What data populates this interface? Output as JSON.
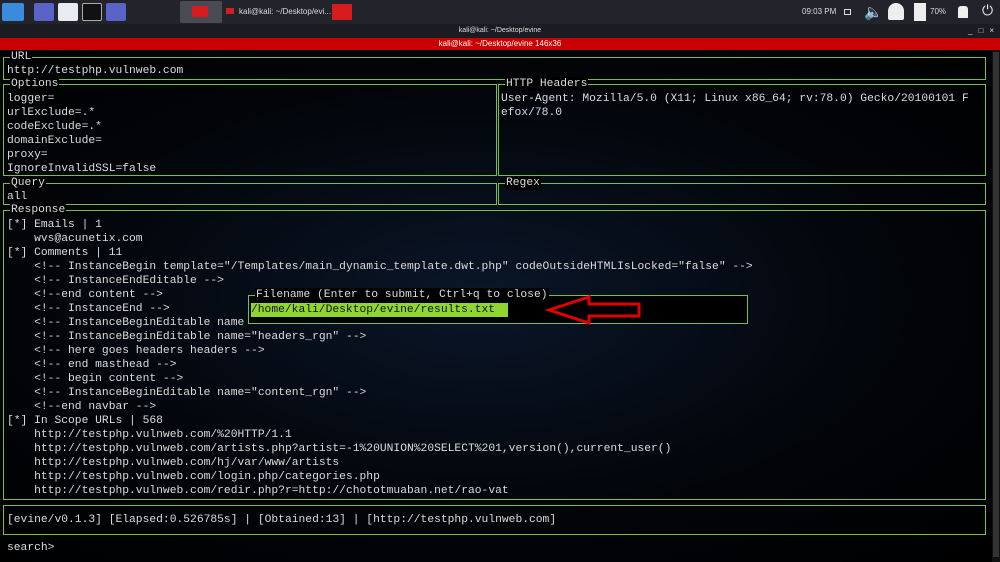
{
  "taskbar": {
    "window_title": "kali@kali: ~/Desktop/evi...",
    "clock": "09:03 PM",
    "battery": "70%",
    "icons": [
      "kali-logo-icon",
      "workspace-icon",
      "folder-icon",
      "terminal-icon",
      "screen-recorder-icon",
      "volume-icon",
      "bell-icon",
      "battery-icon",
      "lock-icon",
      "logout-icon"
    ]
  },
  "window": {
    "title": "kali@kali: ~/Desktop/evine",
    "tab_title": "kali@kali: ~/Desktop/evine 146x36",
    "controls": [
      "_",
      "□",
      "×"
    ]
  },
  "url": {
    "label": "URL",
    "value": "http://testphp.vulnweb.com"
  },
  "options": {
    "label": "Options",
    "lines": [
      "logger=",
      "urlExclude=.*",
      "codeExclude=.*",
      "domainExclude=",
      "proxy=",
      "IgnoreInvalidSSL=false"
    ]
  },
  "headers": {
    "label": "HTTP Headers",
    "lines": [
      "User-Agent: Mozilla/5.0 (X11; Linux x86_64; rv:78.0) Gecko/20100101 F",
      "efox/78.0"
    ]
  },
  "query": {
    "label": "Query",
    "value": "all"
  },
  "regex": {
    "label": "Regex",
    "value": ""
  },
  "response": {
    "label": "Response",
    "lines": [
      "[*] Emails | 1",
      "    wvs@acunetix.com",
      "[*] Comments | 11",
      "    <!-- InstanceBegin template=\"/Templates/main_dynamic_template.dwt.php\" codeOutsideHTMLIsLocked=\"false\" -->",
      "    <!-- InstanceEndEditable -->",
      "    <!--end content -->",
      "    <!-- InstanceEnd -->",
      "    <!-- InstanceBeginEditable name",
      "    <!-- InstanceBeginEditable name=\"headers_rgn\" -->",
      "    <!-- here goes headers headers -->",
      "    <!-- end masthead -->",
      "    <!-- begin content -->",
      "    <!-- InstanceBeginEditable name=\"content_rgn\" -->",
      "    <!--end navbar -->",
      "[*] In Scope URLs | 568",
      "    http://testphp.vulnweb.com/%20HTTP/1.1",
      "    http://testphp.vulnweb.com/artists.php?artist=-1%20UNION%20SELECT%201,version(),current_user()",
      "    http://testphp.vulnweb.com/hj/var/www/artists",
      "    http://testphp.vulnweb.com/login.php/categories.php",
      "    http://testphp.vulnweb.com/redir.php?r=http://chototmuaban.net/rao-vat"
    ]
  },
  "dialog": {
    "label": "Filename (Enter to submit, Ctrl+q to close)",
    "value": "/home/kali/Desktop/evine/results.txt"
  },
  "status": "[evine/v0.1.3] [Elapsed:0.526785s] | [Obtained:13] | [http://testphp.vulnweb.com]",
  "prompt": "search>",
  "colors": {
    "border": "#76c043",
    "input_bg": "#8fd630",
    "arrow": "#e00000",
    "titlebar": "#c80000"
  }
}
